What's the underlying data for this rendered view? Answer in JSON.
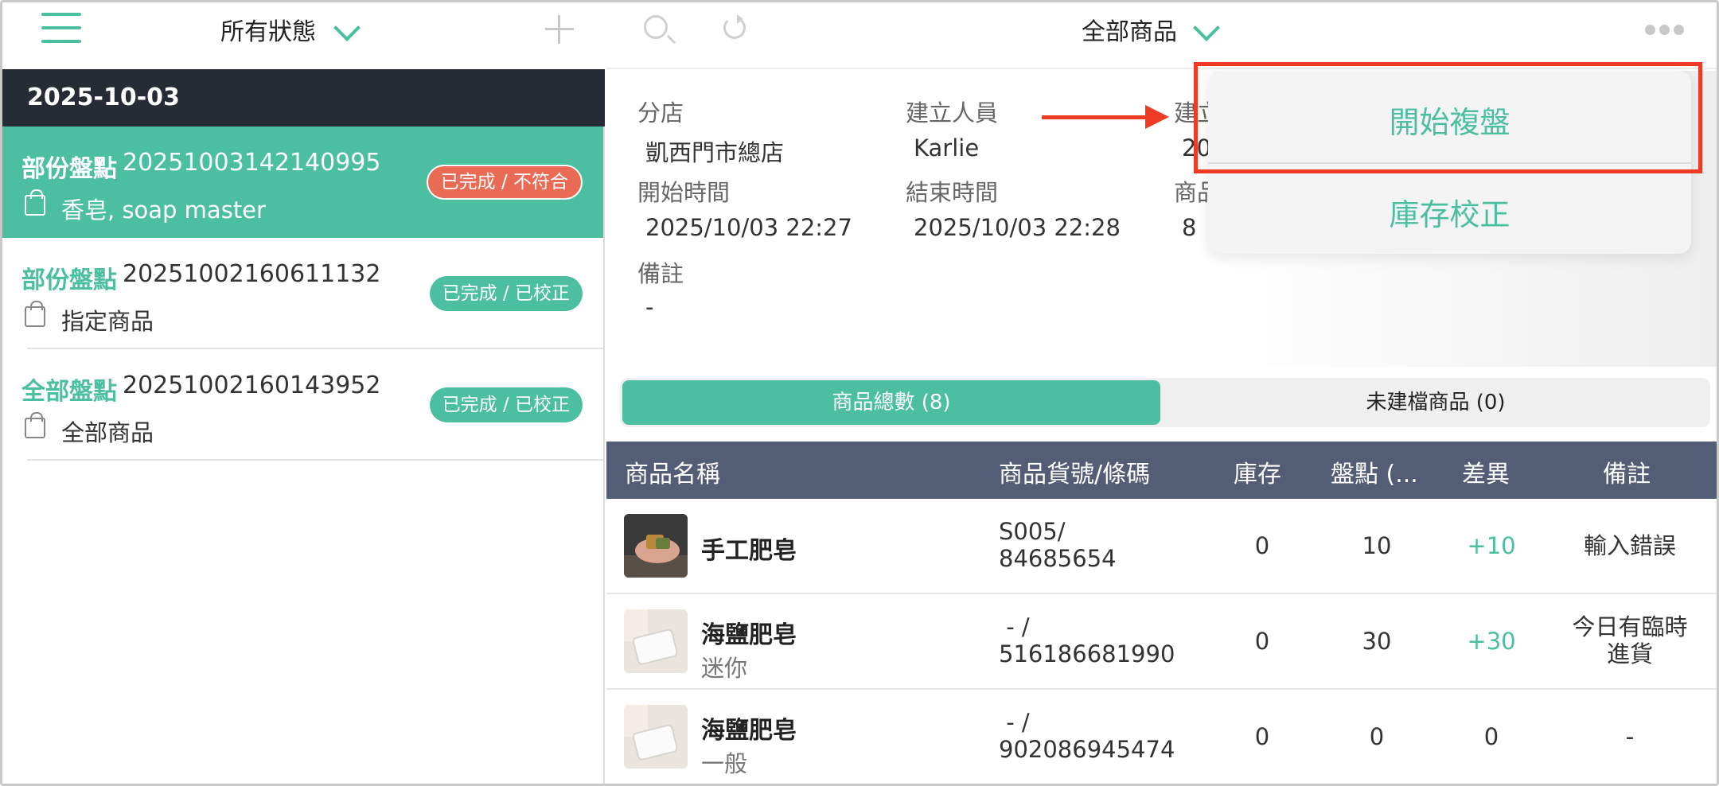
{
  "left_header": {
    "status_filter": "所有狀態"
  },
  "date_header": "2025-10-03",
  "records": [
    {
      "type": "部份盤點",
      "number": "20251003142140995",
      "subtitle": "香皂, soap master",
      "badge": "已完成 / 不符合"
    },
    {
      "type": "部份盤點",
      "number": "20251002160611132",
      "subtitle": "指定商品",
      "badge": "已完成 / 已校正"
    },
    {
      "type": "全部盤點",
      "number": "20251002160143952",
      "subtitle": "全部商品",
      "badge": "已完成 / 已校正"
    }
  ],
  "right_header": {
    "product_filter": "全部商品"
  },
  "info": {
    "store_label": "分店",
    "store_value": "凱西門市總店",
    "creator_label": "建立人員",
    "creator_value": "Karlie",
    "third_label_partial": "建立",
    "third_value_partial": "20",
    "start_label": "開始時間",
    "start_value": "2025/10/03 22:27",
    "end_label": "結束時間",
    "end_value": "2025/10/03 22:28",
    "items_label_partial": "商品",
    "items_value_partial": "8",
    "note_label": "備註",
    "note_value": "-"
  },
  "tabs": {
    "total": "商品總數 (8)",
    "unregistered": "未建檔商品 (0)"
  },
  "table": {
    "headers": {
      "name": "商品名稱",
      "code": "商品貨號/條碼",
      "stock": "庫存",
      "count": "盤點 (...",
      "diff": "差異",
      "note": "備註"
    },
    "rows": [
      {
        "name": "手工肥皂",
        "variant": "",
        "code1": "S005/",
        "code2": "84685654",
        "stock": "0",
        "count": "10",
        "diff": "+10",
        "note": "輸入錯誤"
      },
      {
        "name": "海鹽肥皂",
        "variant": "迷你",
        "code1": " - /",
        "code2": "516186681990",
        "stock": "0",
        "count": "30",
        "diff": "+30",
        "note": "今日有臨時進貨"
      },
      {
        "name": "海鹽肥皂",
        "variant": "一般",
        "code1": " - /",
        "code2": "902086945474",
        "stock": "0",
        "count": "0",
        "diff": "0",
        "note": "-"
      }
    ]
  },
  "menu": {
    "start_recount": "開始複盤",
    "stock_correction": "庫存校正"
  },
  "colors": {
    "accent": "#4bbf9f",
    "dark_header": "#262b36",
    "table_header": "#545d76",
    "alert": "#e96a55",
    "annotation": "#ef3b24"
  },
  "icons": [
    "menu-icon",
    "chevron-down-icon",
    "plus-icon",
    "bag-icon",
    "search-icon",
    "refresh-icon",
    "more-icon"
  ]
}
